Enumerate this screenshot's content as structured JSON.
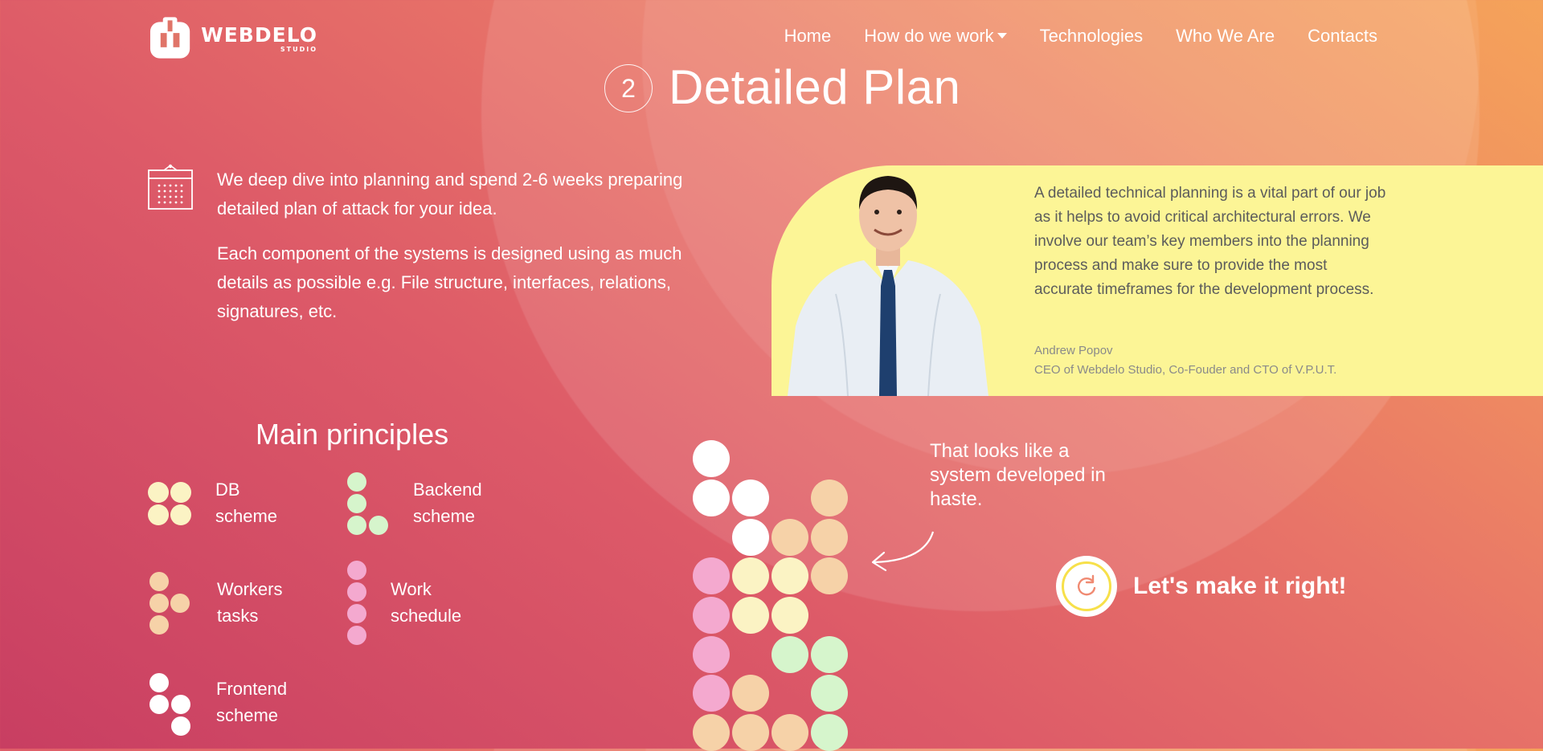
{
  "header": {
    "logo": {
      "name": "WEBDELO",
      "sub": "STUDIO"
    },
    "nav": [
      {
        "label": "Home"
      },
      {
        "label": "How do we work",
        "dropdown": true
      },
      {
        "label": "Technologies"
      },
      {
        "label": "Who We Are"
      },
      {
        "label": "Contacts"
      }
    ]
  },
  "section": {
    "step_number": "2",
    "title": "Detailed Plan",
    "intro": [
      "We deep dive into planning and spend 2-6 weeks preparing detailed plan of attack for your idea.",
      "Each component of the systems is designed using as much details as possible e.g. File structure, interfaces, relations, signatures, etc."
    ]
  },
  "quote": {
    "text": "A detailed technical planning is a vital part of our job as it helps to avoid critical architectural errors. We involve our team’s key members into the planning process and make sure to provide the most accurate timeframes for the development process.",
    "author": "Andrew Popov",
    "role": "CEO of Webdelo Studio, Co-Fouder and CTO of V.P.U.T.",
    "background": "#fcf596"
  },
  "principles": {
    "title": "Main principles",
    "items": [
      {
        "line1": "DB",
        "line2": "scheme",
        "color": "#fbf3c4"
      },
      {
        "line1": "Backend",
        "line2": "scheme",
        "color": "#d6f5cc"
      },
      {
        "line1": "Workers",
        "line2": "tasks",
        "color": "#f6d2a8"
      },
      {
        "line1": "Work",
        "line2": "schedule",
        "color": "#f4a9cf"
      },
      {
        "line1": "Frontend",
        "line2": "scheme",
        "color": "#ffffff"
      }
    ]
  },
  "haste": {
    "text": "That looks like a system developed in haste."
  },
  "cta": {
    "label": "Let's make it right!",
    "icon": "reload-icon",
    "ring_color": "#f7e04a"
  },
  "colors": {
    "white": "#ffffff",
    "cream": "#fbf3c4",
    "peach": "#f6d2a8",
    "pink": "#f4a9cf",
    "green": "#d6f5cc"
  }
}
